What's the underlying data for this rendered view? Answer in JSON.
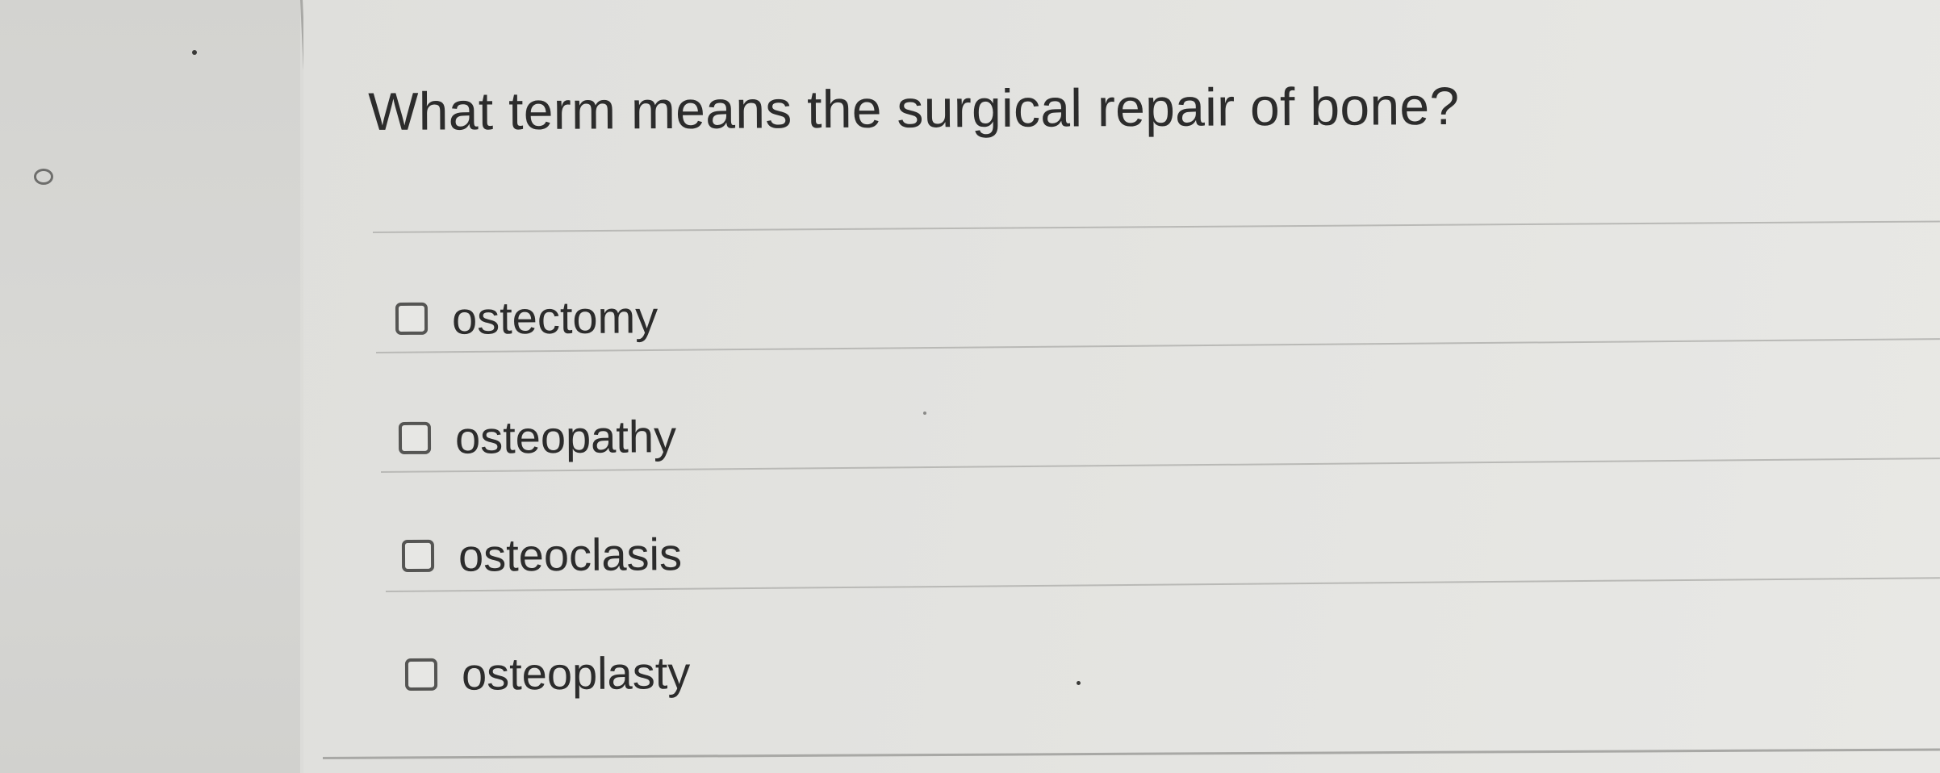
{
  "question": {
    "text": "What term means the surgical repair of bone?"
  },
  "options": [
    {
      "label": "ostectomy",
      "checked": false
    },
    {
      "label": "osteopathy",
      "checked": false
    },
    {
      "label": "osteoclasis",
      "checked": false
    },
    {
      "label": "osteoplasty",
      "checked": false
    }
  ]
}
